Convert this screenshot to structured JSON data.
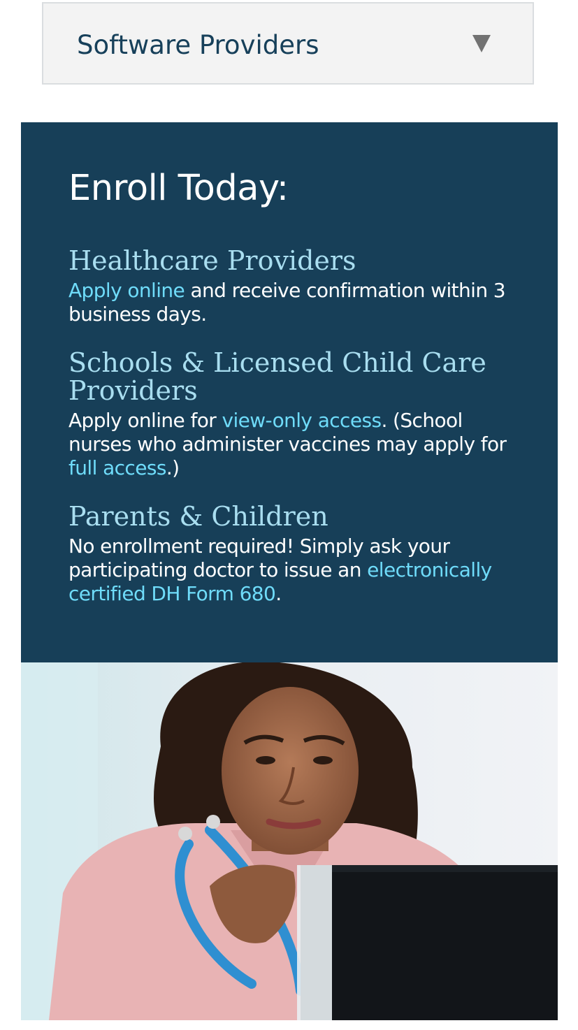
{
  "accordion": {
    "label": "Software Providers",
    "icon": "triangle-down-icon"
  },
  "enroll": {
    "title": "Enroll Today:",
    "healthcare": {
      "heading": "Healthcare Providers",
      "link": "Apply online",
      "text": " and receive confirmation within 3 business days."
    },
    "schools": {
      "heading": "Schools & Licensed Child Care Providers",
      "text_before": "Apply online for ",
      "link1": "view-only access",
      "text_middle": ". (School nurses who administer vaccines may apply for ",
      "link2": "full access",
      "text_after": ".)"
    },
    "parents": {
      "heading": "Parents & Children",
      "text": "No enrollment required! Simply ask your participating doctor to issue an ",
      "link": "electronically certified DH Form 680",
      "text_after": "."
    }
  },
  "colors": {
    "panel": "#173f58",
    "heading": "#a9def0",
    "link": "#6fdcfa",
    "accordion_text": "#17405a"
  },
  "photo": {
    "alt": "nurse-with-stethoscope-photo"
  }
}
